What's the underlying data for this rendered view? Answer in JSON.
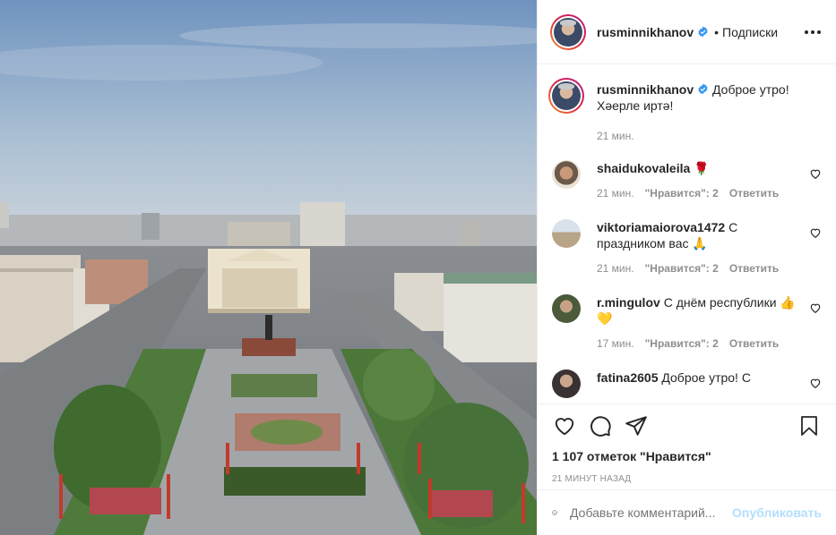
{
  "post": {
    "username": "rusminnikhanov",
    "follow_label": "Подписки",
    "dot": "•"
  },
  "caption": {
    "username": "rusminnikhanov",
    "text": "Доброе утро! Хәерле иртә!",
    "time": "21 мин."
  },
  "comments": [
    {
      "username": "shaidukovaleila",
      "text": "🌹",
      "time": "21 мин.",
      "likes": "\"Нравится\": 2",
      "reply": "Ответить"
    },
    {
      "username": "viktoriamaiorova1472",
      "text": "С праздником вас 🙏",
      "time": "21 мин.",
      "likes": "\"Нравится\": 2",
      "reply": "Ответить"
    },
    {
      "username": "r.mingulov",
      "text": "С днём республики 👍💛",
      "time": "17 мин.",
      "likes": "\"Нравится\": 2",
      "reply": "Ответить"
    },
    {
      "username": "fatina2605",
      "text": "Доброе утро! С",
      "time": "",
      "likes": "",
      "reply": ""
    }
  ],
  "footer": {
    "likes_count": "1 107 отметок \"Нравится\"",
    "time_ago": "21 МИНУТ НАЗАД",
    "add_comment_placeholder": "Добавьте комментарий...",
    "publish_label": "Опубликовать"
  },
  "icons": {
    "like": "heart-icon",
    "comment": "comment-icon",
    "share": "paper-plane-icon",
    "save": "bookmark-icon",
    "emoji": "smiley-icon",
    "more": "ellipsis-icon",
    "verified": "verified-badge-icon"
  },
  "colors": {
    "verified_blue": "#3897f0",
    "publish_disabled": "#b2dffc",
    "muted_text": "#8e8e8e"
  }
}
